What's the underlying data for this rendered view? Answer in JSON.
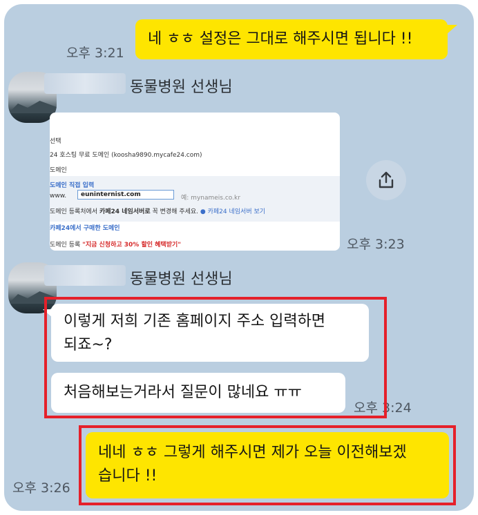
{
  "messages": {
    "m1": {
      "text": "네 ㅎㅎ 설정은 그대로 해주시면 됩니다 !!",
      "time": "오후 3:21"
    },
    "m2": {
      "sender": "동물병원 선생님",
      "time": "오후 3:23"
    },
    "image": {
      "line1": "선택",
      "line2": "24 호스팅 무료 도메인 (koosha9890.mycafe24.com)",
      "line3": "도메인",
      "line4": "도메인 직접 입력",
      "input_value": "euninternist.com",
      "input_hint": "예: mynameis.co.kr",
      "line5_a": "도메인 등록처에서",
      "line5_b": "카페24 네임서버로",
      "line5_c": "꼭 변경해 주세요.",
      "line5_d": "● 카페24 네임서버 보기",
      "line6": "카페24에서 구매한 도메인",
      "line7_a": "도메인 등록",
      "line7_b": "\"지금 신청하고 30% 할인 혜택받기\""
    },
    "m3": {
      "sender": "동물병원 선생님",
      "bubble1_line1": "이렇게 저희 기존 홈페이지 주소 입력하면",
      "bubble1_line2": "되죠~?",
      "bubble2": "처음해보는거라서 질문이 많네요 ㅠㅠ",
      "time": "오후 3:24"
    },
    "m4": {
      "line1": "네네 ㅎㅎ 그렇게 해주시면 제가 오늘 이전해보겠",
      "line2": "습니다 !!",
      "time": "오후 3:26"
    }
  },
  "colors": {
    "chat_bg": "#bacee0",
    "my_bubble": "#fee500",
    "other_bubble": "#ffffff",
    "highlight": "#e5202a"
  },
  "icons": {
    "share": "share-upload-icon"
  }
}
